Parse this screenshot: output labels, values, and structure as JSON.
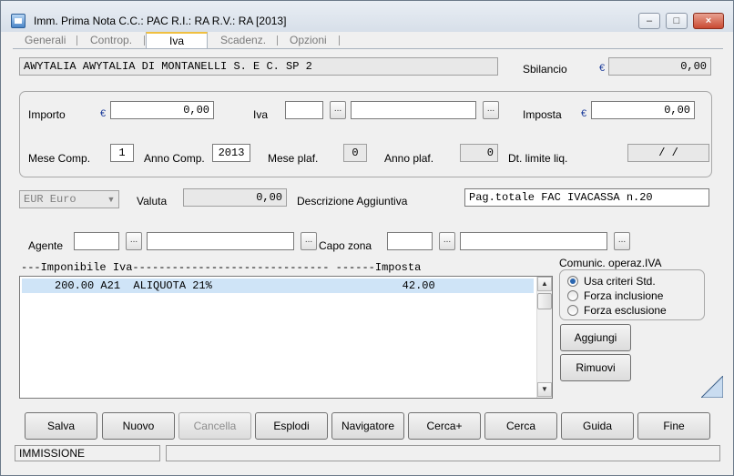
{
  "window": {
    "title": "Imm. Prima Nota C.C.: PAC  R.I.: RA  R.V.: RA  [2013]",
    "minimize_glyph": "–",
    "maximize_glyph": "□",
    "close_glyph": "×"
  },
  "tabs": [
    {
      "label": "Generali",
      "active": false
    },
    {
      "label": "Controp.",
      "active": false
    },
    {
      "label": "Iva",
      "active": true
    },
    {
      "label": "Scadenz.",
      "active": false
    },
    {
      "label": "Opzioni",
      "active": false
    }
  ],
  "header": {
    "customer_line": "AWYTALIA   AWYTALIA DI MONTANELLI S. E C. SP           2",
    "sbilancio_label": "Sbilancio",
    "sbilancio_value": "0,00",
    "currency_symbol": "€"
  },
  "iva_group": {
    "importo_label": "Importo",
    "importo_value": "0,00",
    "iva_label": "Iva",
    "iva_code": "",
    "iva_description": "",
    "imposta_label": "Imposta",
    "imposta_value": "0,00",
    "mese_comp_label": "Mese Comp.",
    "mese_comp_value": "1",
    "anno_comp_label": "Anno Comp.",
    "anno_comp_value": "2013",
    "mese_plaf_label": "Mese plaf.",
    "mese_plaf_value": "0",
    "anno_plaf_label": "Anno plaf.",
    "anno_plaf_value": "0",
    "dt_limite_label": "Dt. limite liq.",
    "dt_limite_value": "/  /",
    "browse_glyph": "..."
  },
  "valuta": {
    "currency_selected": "EUR Euro",
    "valuta_label": "Valuta",
    "valuta_value": "0,00",
    "descrizione_label": "Descrizione Aggiuntiva",
    "descrizione_value": "Pag.totale FAC IVACASSA n.20"
  },
  "agente": {
    "agente_label": "Agente",
    "agente_code": "",
    "agente_desc": "",
    "capo_zona_label": "Capo zona",
    "capo_zona_code": "",
    "capo_zona_desc": ""
  },
  "iva_list": {
    "header": "---Imponibile Iva------------------------------ ------Imposta",
    "rows": [
      {
        "text": "     200.00 A21  ALIQUOTA 21%                             42.00"
      }
    ]
  },
  "comunic": {
    "title": "Comunic. operaz.IVA",
    "options": [
      {
        "label": "Usa criteri Std.",
        "selected": true
      },
      {
        "label": "Forza inclusione",
        "selected": false
      },
      {
        "label": "Forza esclusione",
        "selected": false
      }
    ]
  },
  "side_buttons": {
    "aggiungi": "Aggiungi",
    "rimuovi": "Rimuovi"
  },
  "toolbar": [
    {
      "label": "Salva",
      "enabled": true
    },
    {
      "label": "Nuovo",
      "enabled": true
    },
    {
      "label": "Cancella",
      "enabled": false
    },
    {
      "label": "Esplodi",
      "enabled": true
    },
    {
      "label": "Navigatore",
      "enabled": true
    },
    {
      "label": "Cerca+",
      "enabled": true
    },
    {
      "label": "Cerca",
      "enabled": true
    },
    {
      "label": "Guida",
      "enabled": true
    },
    {
      "label": "Fine",
      "enabled": true
    }
  ],
  "statusbar": {
    "mode": "IMMISSIONE",
    "message": ""
  },
  "colors": {
    "selection": "#cfe4f7",
    "window_bg": "#f0f0f0",
    "readonly_bg": "#e8e8e8"
  }
}
